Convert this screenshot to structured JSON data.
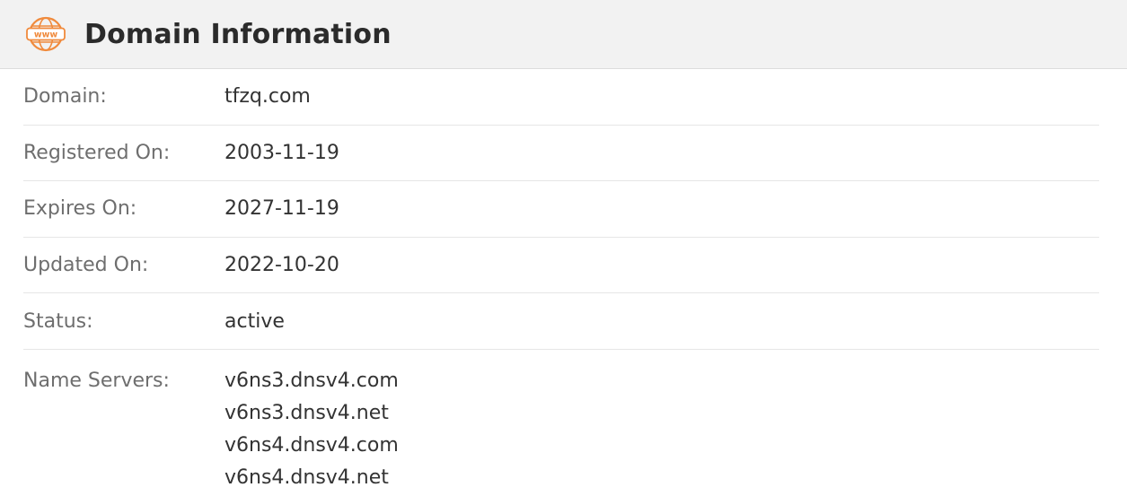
{
  "header": {
    "icon": "www-globe-icon",
    "icon_text": "www",
    "title": "Domain Information",
    "accent_color": "#f08a3c"
  },
  "rows": [
    {
      "label": "Domain:",
      "value": "tfzq.com"
    },
    {
      "label": "Registered On:",
      "value": "2003-11-19"
    },
    {
      "label": "Expires On:",
      "value": "2027-11-19"
    },
    {
      "label": "Updated On:",
      "value": "2022-10-20"
    },
    {
      "label": "Status:",
      "value": "active"
    }
  ],
  "name_servers": {
    "label": "Name Servers:",
    "values": [
      "v6ns3.dnsv4.com",
      "v6ns3.dnsv4.net",
      "v6ns4.dnsv4.com",
      "v6ns4.dnsv4.net"
    ]
  }
}
